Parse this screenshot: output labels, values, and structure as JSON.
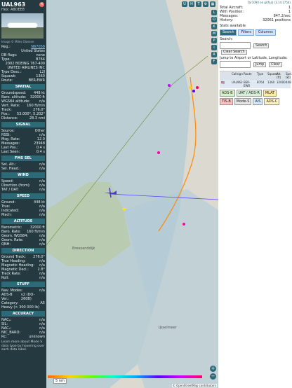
{
  "left": {
    "flight": "UAL963",
    "hex_prefix": "Hex:",
    "hex": "A8DEE8",
    "image_caption": "Image © Miles Glassen",
    "info": {
      "reg_label": "Reg.:",
      "reg": "N67058",
      "country": "United States",
      "db_flags_label": "DB flags:",
      "db_flags": "none",
      "type_label": "Type:",
      "type": "B764",
      "model": "2002 BOEING 767-400",
      "operator": "UNITED AIRLINES INC",
      "type_desc_label": "Type Desc.:",
      "type_desc": "L2J",
      "squawk_label": "Squawk:",
      "squawk": "1360",
      "route_label": "Route:",
      "route": "BER-EWR"
    },
    "spatial": {
      "title": "SPATIAL",
      "groundspeed_label": "Groundspeed:",
      "groundspeed": "448 kt",
      "baro_alt_label": "Baro. altitude:",
      "baro_alt": "32000 ft",
      "wgs84_alt_label": "WGS84 altitude:",
      "wgs84_alt": "n/a",
      "vert_rate_label": "Vert. Rate:",
      "vert_rate": "160 ft/min",
      "track_label": "Track:",
      "track": "276.0°",
      "pos_label": "Pos.:",
      "pos": "53.000°, 5.202°",
      "distance_label": "Distance:",
      "distance": "28.3 nmi"
    },
    "signal": {
      "title": "SIGNAL",
      "source_label": "Source:",
      "source": "Other",
      "rssi_label": "RSSI:",
      "rssi": "n/a",
      "msg_rate_label": "Msg. Rate:",
      "msg_rate": "12.0",
      "messages_label": "Messages:",
      "messages": "23948",
      "last_pos_label": "Last Pos.:",
      "last_pos": "0.4 s",
      "last_seen_label": "Last Seen:",
      "last_seen": "0.4 s"
    },
    "fms": {
      "title": "FMS SEL",
      "sel_alt_label": "Sel. Alt.:",
      "sel_alt": "n/a",
      "sel_head_label": "Sel. Head.:",
      "sel_head": "n/a"
    },
    "wind": {
      "title": "WIND",
      "speed_label": "Speed:",
      "speed": "n/a",
      "direction_label": "Direction (from):",
      "direction": "n/a",
      "tat_oat_label": "TAT / OAT:",
      "tat_oat": "n/a"
    },
    "speed": {
      "title": "SPEED",
      "ground_label": "Ground:",
      "ground": "448 kt",
      "true_label": "True:",
      "true": "n/a",
      "indicated_label": "Indicated:",
      "indicated": "n/a",
      "mach_label": "Mach:",
      "mach": "n/a"
    },
    "altitude": {
      "title": "ALTITUDE",
      "barometric_label": "Barometric:",
      "barometric": "32000 ft",
      "baro_rate_label": "Baro. Rate:",
      "baro_rate": "160 ft/min",
      "geom_wgs84_label": "Geom. WGS84:",
      "geom_wgs84": "n/a",
      "geom_rate_label": "Geom. Rate:",
      "geom_rate": "n/a",
      "qnh_label": "QNH:",
      "qnh": "n/a"
    },
    "direction": {
      "title": "DIRECTION",
      "ground_track_label": "Ground Track:",
      "ground_track": "276.0°",
      "true_heading_label": "True Heading:",
      "true_heading": "n/a",
      "magnetic_heading_label": "Magnetic Heading:",
      "magnetic_heading": "n/a",
      "magnetic_decl_label": "Magnetic Decl.:",
      "magnetic_decl": "2.8°",
      "track_rate_label": "Track Rate:",
      "track_rate": "n/a",
      "roll_label": "Roll:",
      "roll": "n/a"
    },
    "stuff": {
      "title": "STUFF",
      "nav_modes_label": "Nav. Modes:",
      "nav_modes": "n/a",
      "adsb_ver_label": "ADS-B Ver.:",
      "adsb_ver": "v2 (DO-260B)",
      "category_label": "Category:",
      "category": "A5",
      "category_desc": "Heavy (> 300 000 lb)"
    },
    "accuracy": {
      "title": "ACCURACY",
      "nacp_label": "NACₚ:",
      "nacp": "n/a",
      "sil_label": "SIL:",
      "sil": "n/a",
      "nacv_label": "NACᵥ:",
      "nacv": "n/a",
      "nic_baro_label": "NIC_BARO:",
      "nic_baro": "n/a",
      "rc_label": "Rc:",
      "rc": "unknown"
    },
    "note": "Learn more about Mode S data type by hovering over each data label."
  },
  "map": {
    "top_buttons": [
      "U",
      "H",
      "T"
    ],
    "vert_buttons": [
      "L",
      "O",
      "K",
      "M",
      "P",
      "I",
      "R",
      "F"
    ],
    "scale": "5 nm",
    "attribution": "© OpenStreetMap contributors",
    "labels": [
      "Breezanddijk",
      "IJsselmeer"
    ]
  },
  "right": {
    "generated": "tar1090 on github (3.14.1754)",
    "total_aircraft_label": "Total Aircraft:",
    "total_aircraft": "1",
    "with_position_label": "With Position:",
    "with_position": "1",
    "messages_label": "Messages:",
    "messages": "847.2/sec",
    "history_label": "History:",
    "history": "32061 positions",
    "stats_label": "Stats available",
    "tabs": [
      "Search",
      "Filters",
      "Columns"
    ],
    "search_label": "Search:",
    "search_button": "Search",
    "clear_search": "Clear Search",
    "jump_label": "Jump to Airport or Latitude, Longitude:",
    "jump_button": "Jump",
    "clear_button": "Clear",
    "table_headers": [
      "Callsign",
      "Route",
      "Type",
      "Squawk",
      "Alt. (ft)",
      "Spd. (kt)"
    ],
    "row": [
      "UAL963",
      "BER-EWR",
      "B764",
      "1360",
      "32000",
      "448"
    ],
    "legend": [
      "ADS-B",
      "UAT / ADS-R",
      "MLAT",
      "TIS-B",
      "Mode-S",
      "AIS",
      "ADS-C"
    ]
  }
}
